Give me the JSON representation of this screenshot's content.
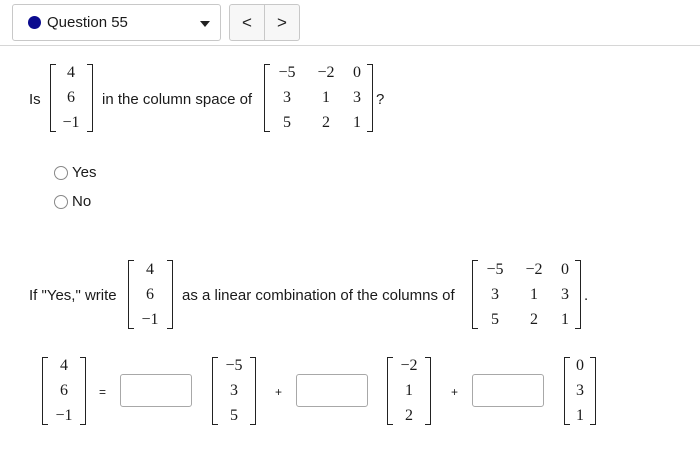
{
  "header": {
    "question_label": "Question 55",
    "status_color": "#0b0b8f",
    "prev_label": "<",
    "next_label": ">"
  },
  "q1": {
    "prefix": "Is",
    "middle": "in the column space of",
    "suffix": "?",
    "vector": [
      "4",
      "6",
      "−1"
    ],
    "matrix": [
      [
        "−5",
        "−2",
        "0"
      ],
      [
        "3",
        "1",
        "3"
      ],
      [
        "5",
        "2",
        "1"
      ]
    ]
  },
  "options": {
    "yes": "Yes",
    "no": "No"
  },
  "q2": {
    "prefix": "If \"Yes,\" write",
    "middle": "as a linear combination of the columns of",
    "suffix": "."
  },
  "equation": {
    "equals": "=",
    "plus": "+",
    "col1": [
      "−5",
      "3",
      "5"
    ],
    "col2": [
      "−2",
      "1",
      "2"
    ],
    "col3": [
      "0",
      "3",
      "1"
    ]
  }
}
